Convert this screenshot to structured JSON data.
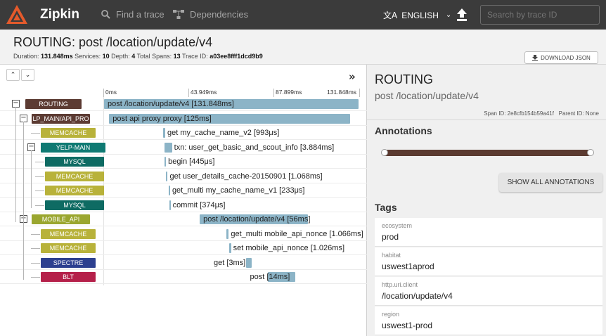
{
  "app": {
    "name": "Zipkin",
    "nav_find": "Find a trace",
    "nav_dependencies": "Dependencies",
    "language": "ENGLISH",
    "search_placeholder": "Search by trace ID"
  },
  "trace": {
    "title_service": "ROUTING:",
    "title_span": "post /location/update/v4",
    "summary": {
      "duration_label": "Duration:",
      "duration": "131.848ms",
      "services_label": "Services:",
      "services": "10",
      "depth_label": "Depth:",
      "depth": "4",
      "total_spans_label": "Total Spans:",
      "total_spans": "13",
      "trace_id_label": "Trace ID:",
      "trace_id": "a03ee8fff1dcd9b9"
    },
    "download_label": "DOWNLOAD JSON"
  },
  "timeline": {
    "ticks": [
      "0ms",
      "43.949ms",
      "87.899ms",
      "131.848ms"
    ],
    "spans": [
      {
        "service": "ROUTING",
        "name": "post /location/update/v4 [131.848ms]",
        "color": "#5c3b33",
        "start": 0,
        "dur": 1.0
      },
      {
        "service": "LP_MAIN/API_PRO",
        "name": "post api proxy proxy [125ms]",
        "color": "#5c3b33",
        "start": 0.02,
        "dur": 0.948
      },
      {
        "service": "MEMCACHE",
        "name": "get my_cache_name_v2 [993μs]",
        "color": "#b8b23a",
        "start": 0.233,
        "dur": 0.0075
      },
      {
        "service": "YELP-MAIN",
        "name": "txn: user_get_basic_and_scout_info [3.884ms]",
        "color": "#0f7a73",
        "start": 0.237,
        "dur": 0.03
      },
      {
        "service": "MYSQL",
        "name": "begin [445μs]",
        "color": "#0e6b63",
        "start": 0.238,
        "dur": 0.004
      },
      {
        "service": "MEMCACHE",
        "name": "get user_details_cache-20150901 [1.068ms]",
        "color": "#b8b23a",
        "start": 0.242,
        "dur": 0.008
      },
      {
        "service": "MEMCACHE",
        "name": "get_multi my_cache_name_v1 [233μs]",
        "color": "#b8b23a",
        "start": 0.254,
        "dur": 0.003
      },
      {
        "service": "MYSQL",
        "name": "commit [374μs]",
        "color": "#0e6b63",
        "start": 0.256,
        "dur": 0.003
      },
      {
        "service": "MOBILE_API",
        "name": "post /location/update/v4 [56ms]",
        "color": "#9aa62f",
        "start": 0.376,
        "dur": 0.425
      },
      {
        "service": "MEMCACHE",
        "name": "get_multi mobile_api_nonce [1.066ms]",
        "color": "#b8b23a",
        "start": 0.482,
        "dur": 0.008
      },
      {
        "service": "MEMCACHE",
        "name": "set mobile_api_nonce [1.026ms]",
        "color": "#b8b23a",
        "start": 0.491,
        "dur": 0.008
      },
      {
        "service": "SPECTRE",
        "name": "get [3ms]",
        "color": "#2c3f8f",
        "start": 0.558,
        "dur": 0.023
      },
      {
        "service": "BLT",
        "name": "post [14ms]",
        "color": "#b5204a",
        "start": 0.645,
        "dur": 0.106
      }
    ]
  },
  "detail": {
    "service": "ROUTING",
    "span_name": "post /location/update/v4",
    "span_id_label": "Span ID:",
    "span_id": "2e8cfb154b59a41f",
    "parent_id_label": "Parent ID:",
    "parent_id": "None",
    "annotations_heading": "Annotations",
    "show_all_label": "SHOW ALL ANNOTATIONS",
    "tags_heading": "Tags",
    "tags": [
      {
        "key": "ecosystem",
        "value": "prod"
      },
      {
        "key": "habitat",
        "value": "uswest1aprod"
      },
      {
        "key": "http.uri.client",
        "value": "/location/update/v4"
      },
      {
        "key": "region",
        "value": "uswest1-prod"
      }
    ]
  }
}
